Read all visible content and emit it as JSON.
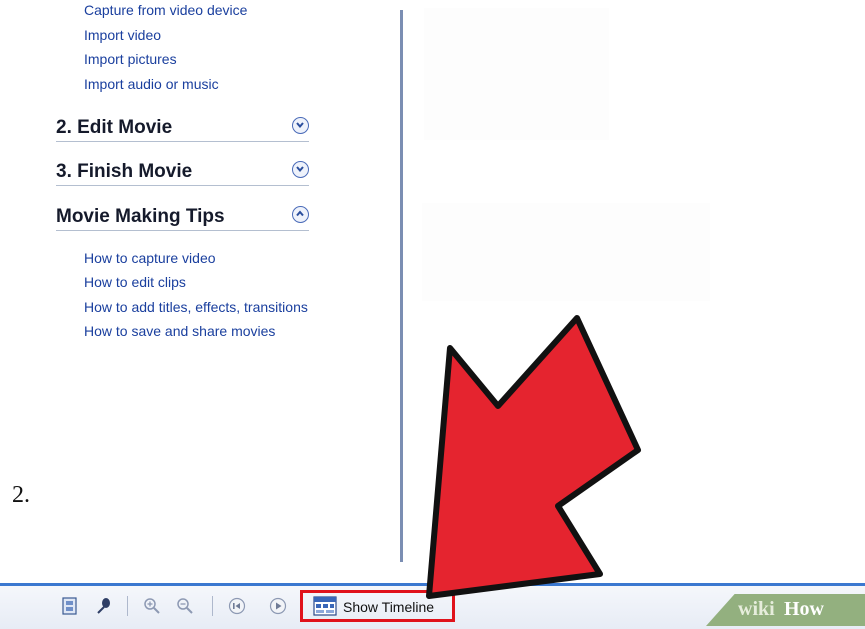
{
  "task_pane": {
    "capture_links": [
      "Capture from video device",
      "Import video",
      "Import pictures",
      "Import audio or music"
    ],
    "sections": [
      {
        "title": "2. Edit Movie",
        "toggle": "chevron-down-icon"
      },
      {
        "title": "3. Finish Movie",
        "toggle": "chevron-down-icon"
      },
      {
        "title": "Movie Making Tips",
        "toggle": "chevron-up-icon"
      }
    ],
    "tip_links": [
      "How to capture video",
      "How to edit clips",
      "How to add titles, effects, transitions",
      "How to save and share movies"
    ]
  },
  "step_number": "2.",
  "toolbar": {
    "icons": [
      "storyboard-icon",
      "narrate-icon",
      "zoom-in-icon",
      "zoom-out-icon",
      "rewind-icon",
      "play-icon"
    ],
    "show_timeline_label": "Show Timeline"
  },
  "watermark": {
    "part1": "wiki",
    "part2": "How"
  },
  "colors": {
    "link": "#1a3f9e",
    "highlight": "#e0121b",
    "arrow": "#e5242f",
    "toolbar_border": "#3b78d0"
  }
}
